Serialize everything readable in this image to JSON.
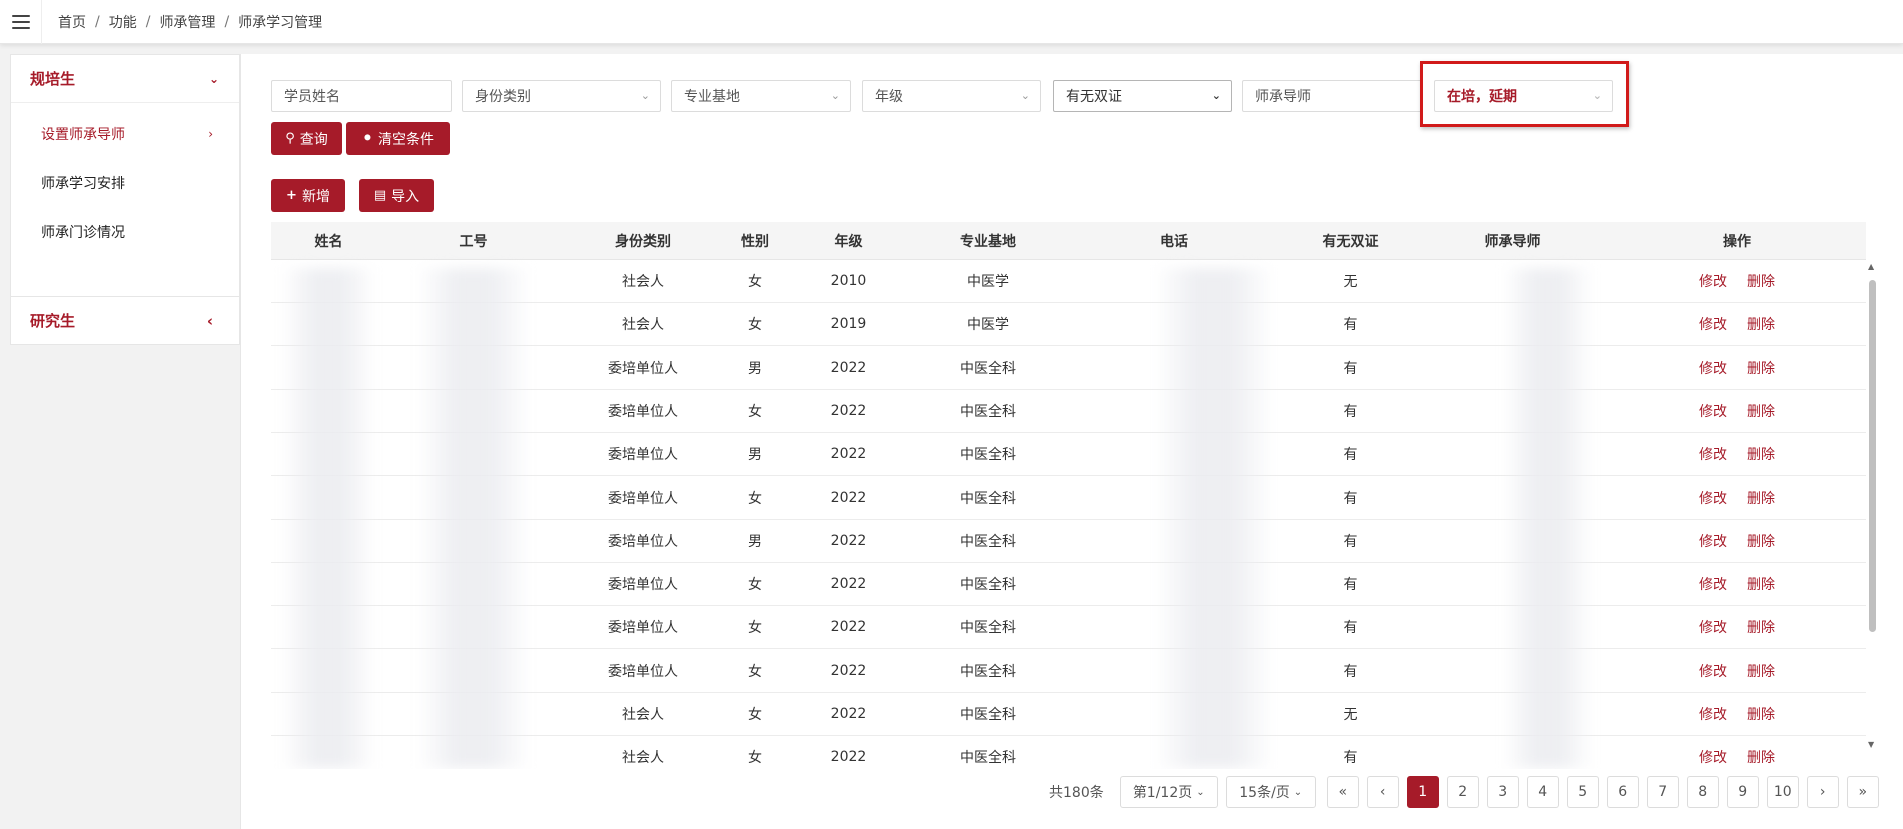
{
  "breadcrumb": [
    "首页",
    "功能",
    "师承管理",
    "师承学习管理"
  ],
  "sidebar": {
    "group1": {
      "title": "规培生",
      "items": [
        {
          "label": "设置师承导师",
          "active": true
        },
        {
          "label": "师承学习安排",
          "active": false
        },
        {
          "label": "师承门诊情况",
          "active": false
        }
      ]
    },
    "group2": {
      "title": "研究生"
    }
  },
  "filters": {
    "name_placeholder": "学员姓名",
    "identity": "身份类别",
    "base": "专业基地",
    "grade": "年级",
    "cert": "有无双证",
    "tutor_placeholder": "师承导师",
    "status": "在培，延期"
  },
  "buttons": {
    "query": "查询",
    "clear": "清空条件",
    "add": "新增",
    "import": "导入"
  },
  "table": {
    "headers": [
      "姓名",
      "工号",
      "身份类别",
      "性别",
      "年级",
      "专业基地",
      "电话",
      "有无双证",
      "师承导师",
      "操作"
    ],
    "edit_label": "修改",
    "delete_label": "删除",
    "rows": [
      {
        "identity": "社会人",
        "gender": "女",
        "grade": "2010",
        "base": "中医学",
        "cert": "无"
      },
      {
        "identity": "社会人",
        "gender": "女",
        "grade": "2019",
        "base": "中医学",
        "cert": "有"
      },
      {
        "identity": "委培单位人",
        "gender": "男",
        "grade": "2022",
        "base": "中医全科",
        "cert": "有"
      },
      {
        "identity": "委培单位人",
        "gender": "女",
        "grade": "2022",
        "base": "中医全科",
        "cert": "有"
      },
      {
        "identity": "委培单位人",
        "gender": "男",
        "grade": "2022",
        "base": "中医全科",
        "cert": "有"
      },
      {
        "identity": "委培单位人",
        "gender": "女",
        "grade": "2022",
        "base": "中医全科",
        "cert": "有"
      },
      {
        "identity": "委培单位人",
        "gender": "男",
        "grade": "2022",
        "base": "中医全科",
        "cert": "有"
      },
      {
        "identity": "委培单位人",
        "gender": "女",
        "grade": "2022",
        "base": "中医全科",
        "cert": "有"
      },
      {
        "identity": "委培单位人",
        "gender": "女",
        "grade": "2022",
        "base": "中医全科",
        "cert": "有"
      },
      {
        "identity": "委培单位人",
        "gender": "女",
        "grade": "2022",
        "base": "中医全科",
        "cert": "有"
      },
      {
        "identity": "社会人",
        "gender": "女",
        "grade": "2022",
        "base": "中医全科",
        "cert": "无"
      },
      {
        "identity": "社会人",
        "gender": "女",
        "grade": "2022",
        "base": "中医全科",
        "cert": "有"
      }
    ]
  },
  "pagination": {
    "total": "共180条",
    "page_select": "第1/12页",
    "size_select": "15条/页",
    "pages": [
      "1",
      "2",
      "3",
      "4",
      "5",
      "6",
      "7",
      "8",
      "9",
      "10"
    ],
    "current": "1"
  },
  "colors": {
    "accent": "#a61b29",
    "highlight": "#d11a1a"
  }
}
